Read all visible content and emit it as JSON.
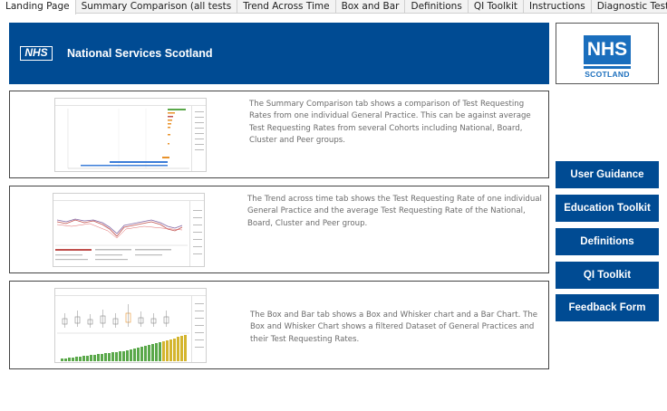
{
  "tabs": [
    {
      "label": "Landing Page",
      "active": true
    },
    {
      "label": "Summary Comparison (all tests",
      "active": false
    },
    {
      "label": "Trend Across Time",
      "active": false
    },
    {
      "label": "Box and Bar",
      "active": false
    },
    {
      "label": "Definitions",
      "active": false
    },
    {
      "label": "QI Toolkit",
      "active": false
    },
    {
      "label": "Instructions",
      "active": false
    },
    {
      "label": "Diagnostic Tests",
      "active": false
    }
  ],
  "banner": {
    "logo_text": "NHS",
    "title": "National Services Scotland",
    "background": "#004b93"
  },
  "logo": {
    "nhs": "NHS",
    "sub": "SCOTLAND",
    "color": "#1a6ebd"
  },
  "panels": [
    {
      "text": "The Summary Comparison tab shows a comparison of Test Requesting Rates from one individual General Practice. This can be against average Test Requesting Rates from several Cohorts including National, Board, Cluster and Peer groups."
    },
    {
      "text": "The Trend across time tab shows the Test Requesting Rate of one individual General Practice and the average Test Requesting Rate of the National, Board, Cluster and Peer group."
    },
    {
      "text": "The Box and Bar tab shows a Box and Whisker chart and a Bar Chart. The Box and Whisker Chart shows a filtered Dataset of General Practices and their Test Requesting Rates."
    }
  ],
  "buttons": [
    {
      "label": "User Guidance"
    },
    {
      "label": "Education Toolkit"
    },
    {
      "label": "Definitions"
    },
    {
      "label": "QI Toolkit"
    },
    {
      "label": "Feedback Form"
    }
  ],
  "colors": {
    "accent": "#004b93",
    "thumb_bar_green": "#5aa84a",
    "thumb_bar_orange": "#e8922a",
    "thumb_bar_blue": "#3b7dd8",
    "thumb_line_red": "#c0504d",
    "thumb_line_purple": "#8064a2"
  }
}
